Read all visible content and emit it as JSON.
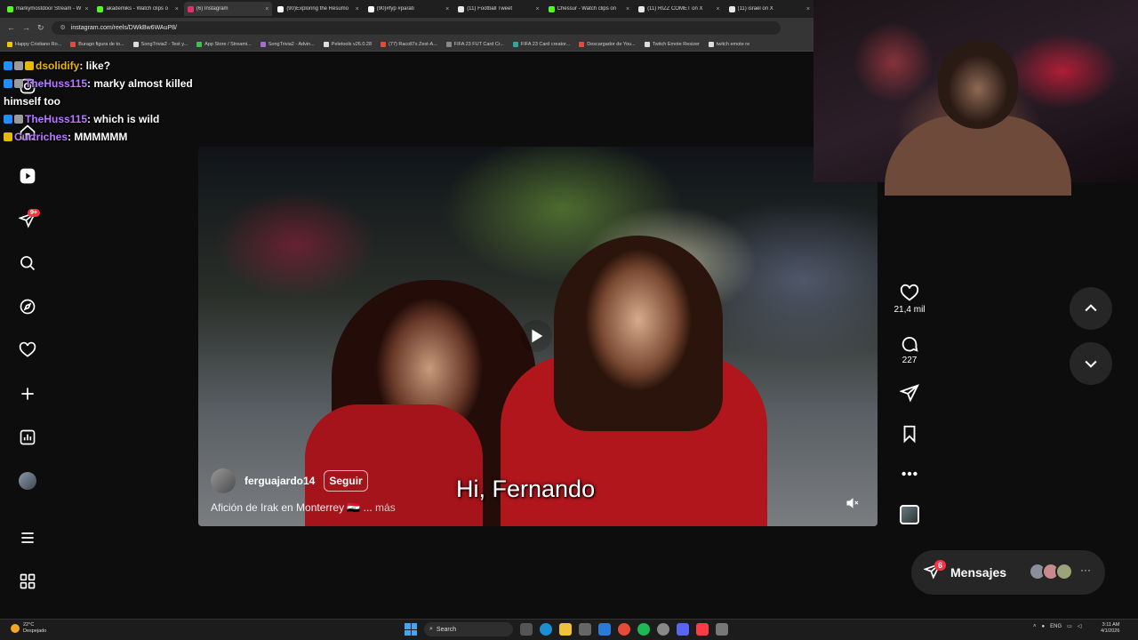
{
  "browser": {
    "tabs": [
      {
        "title": "markymostdoor Stream - W",
        "color": "#53fc18",
        "active": false
      },
      {
        "title": "akademiks - Watch clips o",
        "color": "#53fc18",
        "active": false
      },
      {
        "title": "(6) Instagram",
        "color": "#e1306c",
        "active": true
      },
      {
        "title": "(90)Exploring the Resumo",
        "color": "#ffffff",
        "active": false
      },
      {
        "title": "(90)#fyp #parati",
        "color": "#ffffff",
        "active": false
      },
      {
        "title": "(11) Football Tweet",
        "color": "#e8e8e8",
        "active": false
      },
      {
        "title": "Chessur - Watch clips on",
        "color": "#53fc18",
        "active": false
      },
      {
        "title": "(11) RIZZ COMET on X",
        "color": "#e8e8e8",
        "active": false
      },
      {
        "title": "(11) israel on X",
        "color": "#e8e8e8",
        "active": false
      }
    ],
    "tab_close": "×",
    "url": "instagram.com/reels/DWkBw6WAuP8/",
    "bookmarks": [
      "Happy Cristiano Ro...",
      "Burago figura de to...",
      "SongTrivia2 - Test y...",
      "App Store / Streami...",
      "SongTrivia2 - Advin...",
      "Peletools v26.0.28",
      "(77) Racoll7s Zest-A...",
      "FIFA 23 FUT Card Cr...",
      "FIFA 23 Card creator...",
      "Descargador de You...",
      "Twitch Emote Resizer",
      "twitch emote re"
    ]
  },
  "chat": [
    {
      "user": "dsolidify",
      "user_color": "#e6b800",
      "msg": ": like?",
      "badges": [
        "#1e90ff",
        "#9b9b9b",
        "#e6b800"
      ]
    },
    {
      "user": "TheHuss115",
      "user_color": "#b87aff",
      "msg": ": marky almost killed himself too",
      "badges": [
        "#1e90ff",
        "#9b9b9b"
      ]
    },
    {
      "user": "TheHuss115",
      "user_color": "#b87aff",
      "msg": ": which is wild",
      "badges": [
        "#1e90ff",
        "#9b9b9b"
      ]
    },
    {
      "user": "Curtriches",
      "user_color": "#b87aff",
      "msg": ": MMMMMM",
      "badges": [
        "#e6b800"
      ]
    }
  ],
  "nav": {
    "notifications_badge": "9+"
  },
  "reel": {
    "author": "ferguajardo14",
    "follow_label": "Seguir",
    "caption": "Afición de Irak en Monterrey 🇮🇶 ...",
    "more_label": "más",
    "subtitle": "Hi, Fernando",
    "likes": "21,4 mil",
    "comments": "227"
  },
  "messages": {
    "label": "Mensajes",
    "badge": "6",
    "more": "···"
  },
  "taskbar": {
    "weather_temp": "22°C",
    "weather_desc": "Despejado",
    "search_label": "Search",
    "lang": "ENG",
    "time": "3:11 AM",
    "date": "4/1/2026"
  }
}
